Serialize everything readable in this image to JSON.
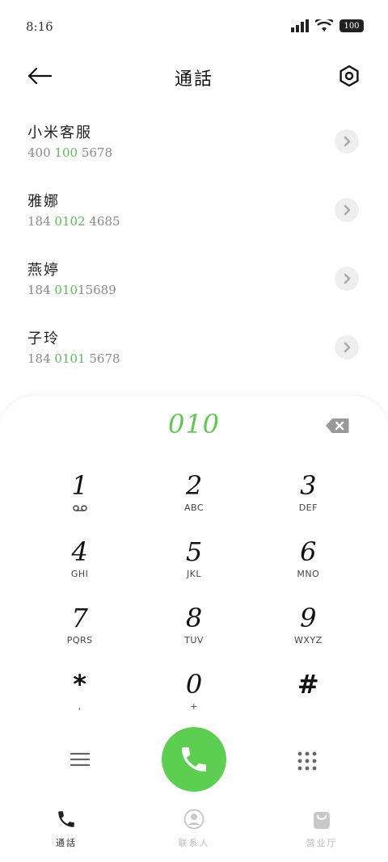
{
  "status_bar": {
    "time": "8:16",
    "battery": "100"
  },
  "header": {
    "title": "通話"
  },
  "contacts": [
    {
      "name": "小米客服",
      "number_prefix": "400 ",
      "number_match": "100",
      "number_rest": " 5678"
    },
    {
      "name": "雅娜",
      "number_prefix": "184 ",
      "number_match": "0102",
      "number_rest": " 4685"
    },
    {
      "name": "燕婷",
      "number_prefix": "184 ",
      "number_match": "010",
      "number_rest": "15689"
    },
    {
      "name": "子玲",
      "number_prefix": "184 ",
      "number_match": "0101",
      "number_rest": " 5678"
    }
  ],
  "dialer": {
    "input": "010",
    "keys": [
      {
        "digit": "1",
        "sub": "voicemail-icon"
      },
      {
        "digit": "2",
        "sub": "ABC"
      },
      {
        "digit": "3",
        "sub": "DEF"
      },
      {
        "digit": "4",
        "sub": "GHI"
      },
      {
        "digit": "5",
        "sub": "JKL"
      },
      {
        "digit": "6",
        "sub": "MNO"
      },
      {
        "digit": "7",
        "sub": "PQRS"
      },
      {
        "digit": "8",
        "sub": "TUV"
      },
      {
        "digit": "9",
        "sub": "WXYZ"
      },
      {
        "digit": "*",
        "sub": ","
      },
      {
        "digit": "0",
        "sub": "+"
      },
      {
        "digit": "#",
        "sub": ""
      }
    ]
  },
  "bottom_nav": {
    "items": [
      {
        "label": "通話",
        "icon": "phone-icon",
        "active": true
      },
      {
        "label": "联系人",
        "icon": "contact-icon",
        "active": false
      },
      {
        "label": "营业厅",
        "icon": "bag-icon",
        "active": false
      }
    ]
  },
  "colors": {
    "accent": "#5ccf53",
    "highlight_text": "#5fb85a",
    "display_text": "#5fc850"
  }
}
